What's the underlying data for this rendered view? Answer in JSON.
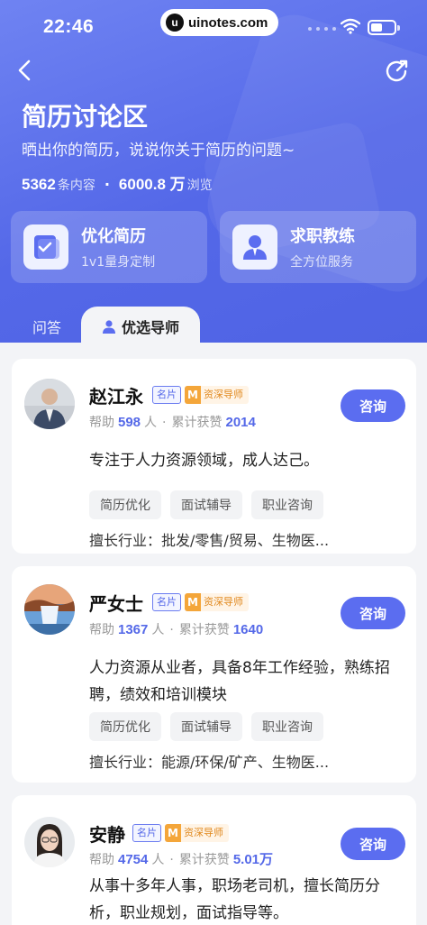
{
  "status_bar": {
    "time": "22:46",
    "watermark": "uinotes.com"
  },
  "header": {
    "title": "简历讨论区",
    "subtitle": "晒出你的简历，说说你关于简历的问题~",
    "stats": {
      "content_count": "5362",
      "content_unit": "条内容",
      "views_count": "6000.8 万",
      "views_unit": "浏览"
    }
  },
  "features": [
    {
      "title": "优化简历",
      "subtitle": "1v1量身定制",
      "icon": "resume-check-icon"
    },
    {
      "title": "求职教练",
      "subtitle": "全方位服务",
      "icon": "coach-person-icon"
    }
  ],
  "tabs": {
    "qa": "问答",
    "mentors": "优选导师"
  },
  "badges": {
    "card": "名片",
    "senior_letter": "M",
    "senior": "资深导师"
  },
  "labels": {
    "help": "帮助",
    "help_unit": "人",
    "likes": "累计获赞",
    "consult": "咨询",
    "industry_prefix": "擅长行业："
  },
  "mentors": [
    {
      "name": "赵江永",
      "help_count": "598",
      "likes": "2014",
      "intro": "专注于人力资源领域，成人达己。",
      "tags": [
        "简历优化",
        "面试辅导",
        "职业咨询"
      ],
      "industry": "批发/零售/贸易、生物医..."
    },
    {
      "name": "严女士",
      "help_count": "1367",
      "likes": "1640",
      "intro": "人力资源从业者，具备8年工作经验，熟练招聘，绩效和培训模块",
      "tags": [
        "简历优化",
        "面试辅导",
        "职业咨询"
      ],
      "industry": "能源/环保/矿产、生物医..."
    },
    {
      "name": "安静",
      "help_count": "4754",
      "likes": "5.01万",
      "intro": "从事十多年人事，职场老司机，擅长简历分析，职业规划，面试指导等。",
      "tags": [],
      "industry": ""
    }
  ],
  "colors": {
    "brand": "#5468e8",
    "accent_orange": "#f4a63a"
  }
}
